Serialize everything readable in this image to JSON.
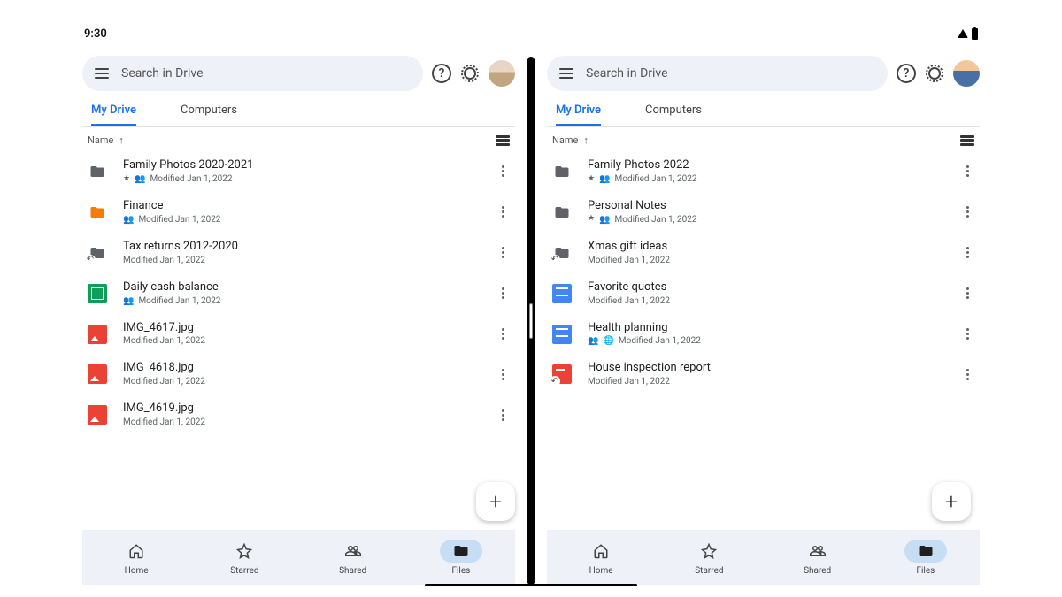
{
  "status": {
    "time": "9:30"
  },
  "panes": [
    {
      "search_placeholder": "Search in Drive",
      "tabs": {
        "my_drive": "My Drive",
        "computers": "Computers",
        "active": "my_drive"
      },
      "column_label": "Name",
      "files": [
        {
          "name": "Family Photos 2020-2021",
          "sub": "Modified Jan 1, 2022",
          "icon": "folder-dark",
          "starred": true,
          "shared": true
        },
        {
          "name": "Finance",
          "sub": "Modified Jan 1, 2022",
          "icon": "folder-orange",
          "shared": true
        },
        {
          "name": "Tax returns 2012-2020",
          "sub": "Modified Jan 1, 2022",
          "icon": "folder-dark",
          "shortcut": true
        },
        {
          "name": "Daily cash balance",
          "sub": "Modified Jan 1, 2022",
          "icon": "sheet",
          "shared": true
        },
        {
          "name": "IMG_4617.jpg",
          "sub": "Modified Jan 1, 2022",
          "icon": "image"
        },
        {
          "name": "IMG_4618.jpg",
          "sub": "Modified Jan 1, 2022",
          "icon": "image"
        },
        {
          "name": "IMG_4619.jpg",
          "sub": "Modified Jan 1, 2022",
          "icon": "image"
        }
      ]
    },
    {
      "search_placeholder": "Search in Drive",
      "tabs": {
        "my_drive": "My Drive",
        "computers": "Computers",
        "active": "my_drive"
      },
      "column_label": "Name",
      "files": [
        {
          "name": "Family Photos 2022",
          "sub": "Modified Jan 1, 2022",
          "icon": "folder-dark",
          "starred": true,
          "shared": true
        },
        {
          "name": "Personal Notes",
          "sub": "Modified Jan 1, 2022",
          "icon": "folder-dark",
          "starred": true,
          "shared": true
        },
        {
          "name": "Xmas gift ideas",
          "sub": "Modified Jan 1, 2022",
          "icon": "folder-dark",
          "shortcut": true
        },
        {
          "name": "Favorite quotes",
          "sub": "Modified Jan 1, 2022",
          "icon": "doc"
        },
        {
          "name": "Health planning",
          "sub": "Modified Jan 1, 2022",
          "icon": "doc",
          "shared": true,
          "globe": true
        },
        {
          "name": "House inspection report",
          "sub": "Modified Jan 1, 2022",
          "icon": "pdf",
          "shortcut": true
        }
      ]
    }
  ],
  "nav": {
    "home": "Home",
    "starred": "Starred",
    "shared": "Shared",
    "files": "Files",
    "active": "files"
  }
}
